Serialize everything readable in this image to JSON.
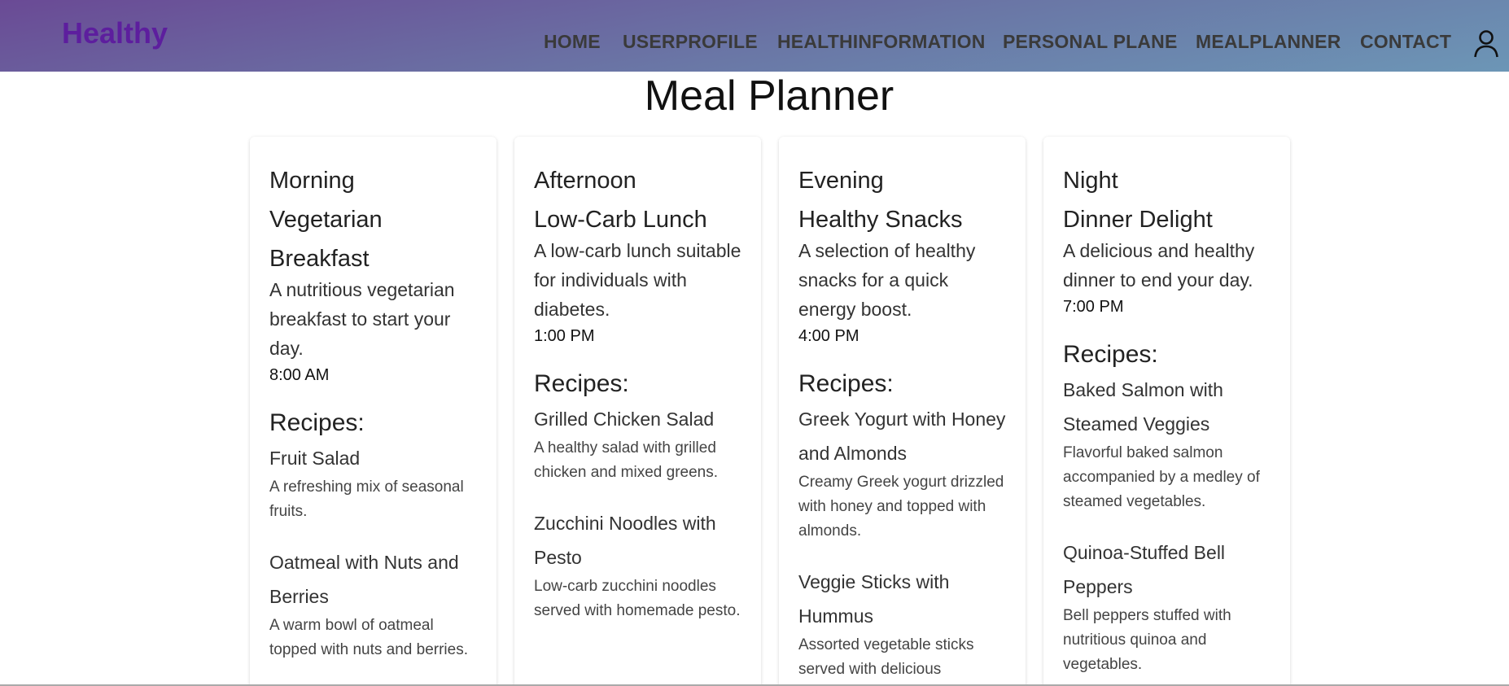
{
  "brand": "Healthy",
  "nav": [
    "HOME",
    "USERPROFILE",
    "HEALTHINFORMATION",
    "PERSONAL PLANE",
    "MEALPLANNER",
    "CONTACT"
  ],
  "page_title": "Meal Planner",
  "recipes_heading": "Recipes:",
  "meals": [
    {
      "time_label": "Morning",
      "title": "Vegetarian Breakfast",
      "description": "A nutritious vegetarian breakfast to start your day.",
      "time": "8:00 AM",
      "recipes": [
        {
          "name": "Fruit Salad",
          "desc": "A refreshing mix of seasonal fruits."
        },
        {
          "name": "Oatmeal with Nuts and Berries",
          "desc": "A warm bowl of oatmeal topped with nuts and berries."
        }
      ]
    },
    {
      "time_label": "Afternoon",
      "title": "Low-Carb Lunch",
      "description": "A low-carb lunch suitable for individuals with diabetes.",
      "time": "1:00 PM",
      "recipes": [
        {
          "name": "Grilled Chicken Salad",
          "desc": "A healthy salad with grilled chicken and mixed greens."
        },
        {
          "name": "Zucchini Noodles with Pesto",
          "desc": "Low-carb zucchini noodles served with homemade pesto."
        }
      ]
    },
    {
      "time_label": "Evening",
      "title": "Healthy Snacks",
      "description": "A selection of healthy snacks for a quick energy boost.",
      "time": "4:00 PM",
      "recipes": [
        {
          "name": "Greek Yogurt with Honey and Almonds",
          "desc": "Creamy Greek yogurt drizzled with honey and topped with almonds."
        },
        {
          "name": "Veggie Sticks with Hummus",
          "desc": "Assorted vegetable sticks served with delicious"
        }
      ]
    },
    {
      "time_label": "Night",
      "title": "Dinner Delight",
      "description": "A delicious and healthy dinner to end your day.",
      "time": "7:00 PM",
      "recipes": [
        {
          "name": "Baked Salmon with Steamed Veggies",
          "desc": "Flavorful baked salmon accompanied by a medley of steamed vegetables."
        },
        {
          "name": "Quinoa-Stuffed Bell Peppers",
          "desc": "Bell peppers stuffed with nutritious quinoa and vegetables."
        }
      ]
    }
  ]
}
